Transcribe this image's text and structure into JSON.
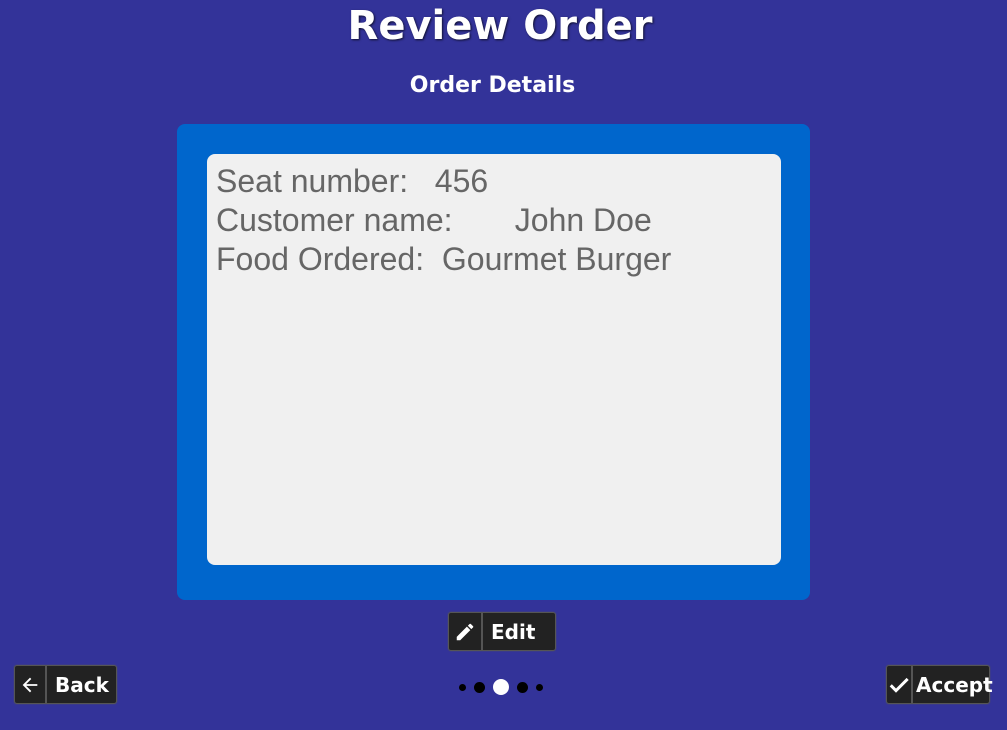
{
  "header": {
    "title": "Review Order",
    "subtitle": "Order Details"
  },
  "order": {
    "seat_label": "Seat number:",
    "seat_value": "456",
    "customer_label": "Customer name:",
    "customer_value": "John Doe",
    "food_label": "Food Ordered:",
    "food_value": "Gourmet Burger"
  },
  "buttons": {
    "edit_label": "Edit",
    "edit_icon": "pencil-icon",
    "back_label": "Back",
    "back_icon": "arrow-left-icon",
    "accept_label": "Accept",
    "accept_icon": "checkmark-icon"
  },
  "pager": {
    "total_pages": 5,
    "current_page": 3
  },
  "colors": {
    "background": "#333399",
    "panel_border": "#0066cc",
    "panel_fill": "#f0f0f0",
    "text_gray": "#666666",
    "button_dark": "#222222"
  }
}
